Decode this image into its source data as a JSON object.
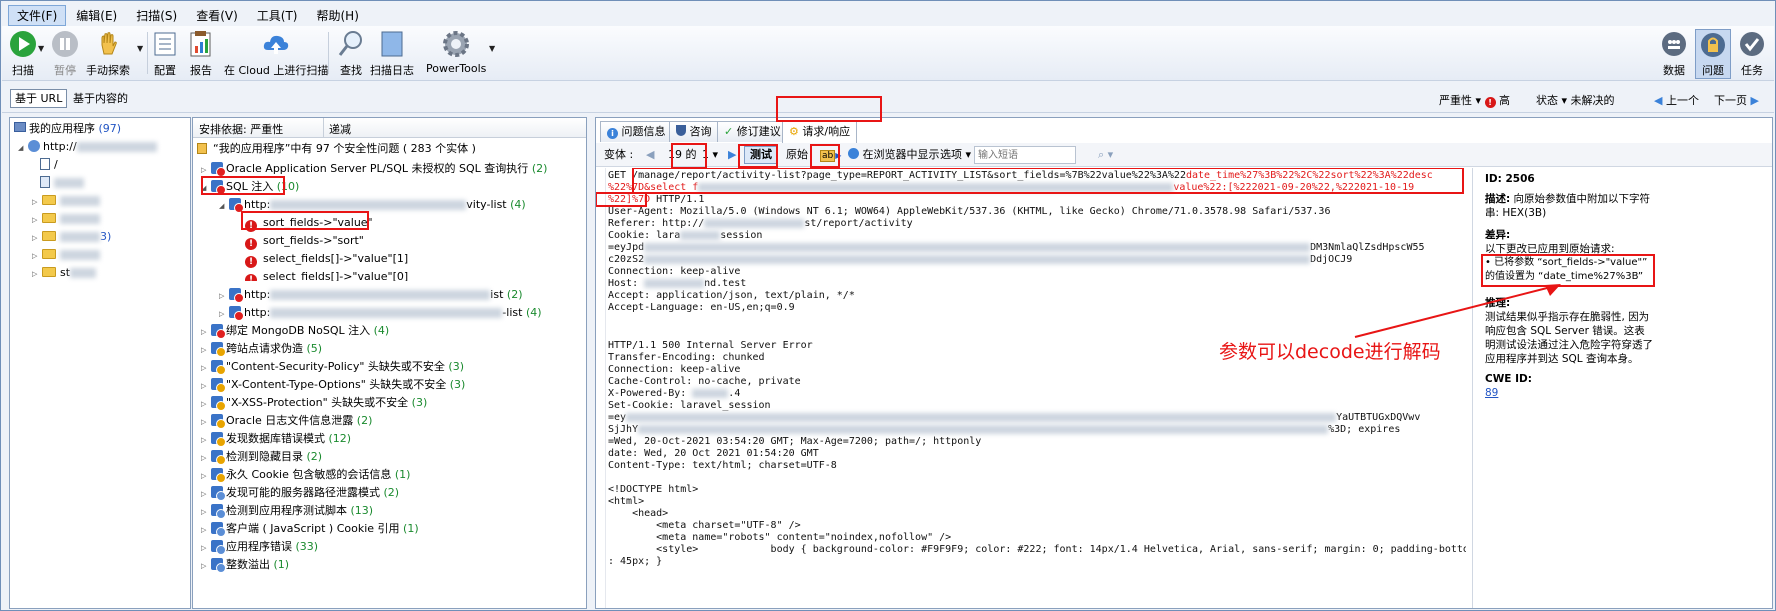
{
  "menu": [
    "文件(F)",
    "编辑(E)",
    "扫描(S)",
    "查看(V)",
    "工具(T)",
    "帮助(H)"
  ],
  "toolbar": {
    "scan": "扫描",
    "pause": "暂停",
    "manual": "手动探索",
    "config": "配置",
    "report": "报告",
    "cloud": "在 Cloud 上进行扫描",
    "find": "查找",
    "scanlog": "扫描日志",
    "powertools": "PowerTools",
    "data": "数据",
    "issues": "问题",
    "tasks": "任务"
  },
  "viewbar": {
    "url": "基于 URL",
    "content": "基于内容的",
    "severity": "严重性",
    "high": "高",
    "state": "状态",
    "unresolved": "未解决的",
    "prev": "上一个",
    "next": "下一页"
  },
  "left": {
    "root": "我的应用程序",
    "root_count": "(97)",
    "host": "http://",
    "item1": "/",
    "item_suffix": "3)",
    "item_st": "st"
  },
  "mid": {
    "col1": "安排依据: 严重性",
    "col2": "递减",
    "summary": "“我的应用程序”中有 97 个安全性问题 ( 283 个实体 )",
    "oracle": "Oracle Application Server PL/SQL 未授权的 SQL 查询执行",
    "oracle_n": "(2)",
    "sqli": "SQL 注入",
    "sqli_n": "(10)",
    "url1": "http:",
    "url1_suffix": "vity-list",
    "url1_n": "(4)",
    "p1": "sort_fields->\"value\"",
    "p2": "sort_fields->\"sort\"",
    "p3": "select_fields[]->\"value\"[1]",
    "p4": "select_fields[]->\"value\"[0]",
    "url2": "http:",
    "url2_suffix": "ist",
    "url2_n": "(2)",
    "url3": "http:",
    "url3_suffix": "-list",
    "url3_n": "(4)",
    "groups": [
      {
        "t": "绑定 MongoDB NoSQL 注入",
        "n": "(4)",
        "c": "red"
      },
      {
        "t": "跨站点请求伪造",
        "n": "(5)",
        "c": "gold"
      },
      {
        "t": "\"Content-Security-Policy\" 头缺失或不安全",
        "n": "(3)",
        "c": "gold"
      },
      {
        "t": "\"X-Content-Type-Options\" 头缺失或不安全",
        "n": "(3)",
        "c": "gold"
      },
      {
        "t": "\"X-XSS-Protection\" 头缺失或不安全",
        "n": "(3)",
        "c": "gold"
      },
      {
        "t": "Oracle 日志文件信息泄露",
        "n": "(2)",
        "c": "gold"
      },
      {
        "t": "发现数据库错误模式",
        "n": "(12)",
        "c": "gold"
      },
      {
        "t": "检测到隐藏目录",
        "n": "(2)",
        "c": "gold"
      },
      {
        "t": "永久 Cookie 包含敏感的会话信息",
        "n": "(1)",
        "c": "gold"
      },
      {
        "t": "发现可能的服务器路径泄露模式",
        "n": "(2)",
        "c": "blue"
      },
      {
        "t": "检测到应用程序测试脚本",
        "n": "(13)",
        "c": "blue"
      },
      {
        "t": "客户端 ( JavaScript ) Cookie 引用",
        "n": "(1)",
        "c": "blue"
      },
      {
        "t": "应用程序错误",
        "n": "(33)",
        "c": "blue"
      },
      {
        "t": "整数溢出",
        "n": "(1)",
        "c": "blue"
      }
    ]
  },
  "tabs": {
    "info": "问题信息",
    "advice": "咨询",
    "fix": "修订建议",
    "reqres": "请求/响应"
  },
  "subtb": {
    "variant": "变体 :",
    "of": "19 的",
    "idx": "1",
    "test": "测试",
    "orig": "原始",
    "browser": "在浏览器中显示",
    "options": "选项",
    "search_placeholder": "输入短语"
  },
  "code": {
    "l1a": "GET /manage/report/activity-list?page_type=REPORT_ACTIVITY_LIST&sort_fields=%7B%22value%22%3A%22",
    "l1b": "date_time%27%3B",
    "l1c": "%22%2C%22sort%22%3A%22desc",
    "l2a": "%22%7D&select_f",
    "l2b": "value%22:[%222021-09-20%22,%222021-10-19",
    "l3a": "%22]%7D",
    "l3b": " HTTP/1.1",
    "l4": "User-Agent: Mozilla/5.0 (Windows NT 6.1; WOW64) AppleWebKit/537.36 (KHTML, like Gecko) Chrome/71.0.3578.98 Safari/537.36",
    "l5a": "Referer: http://",
    "l5b": "st/report/activity",
    "l6a": "Cookie: lara",
    "l6b": "session",
    "l7a": "=eyJpd",
    "l7b": "DM3NmlaQlZsdHpscW55",
    "l8a": "c20zS2",
    "l8b": "DdjOCJ9",
    "l9": "Connection: keep-alive",
    "l10a": "Host: ",
    "l10b": "nd.test",
    "l11": "Accept: application/json, text/plain, */*",
    "l12": "Accept-Language: en-US,en;q=0.9",
    "r1": "HTTP/1.1 500 Internal Server Error",
    "r2": "Transfer-Encoding: chunked",
    "r3": "Connection: keep-alive",
    "r4": "Cache-Control: no-cache, private",
    "r5a": "X-Powered-By: ",
    "r5b": ".4",
    "r6": "Set-Cookie: laravel_session",
    "r7a": "=ey",
    "r7b": "YaUTBTUGxDQVwv",
    "r8a": "SjJhY",
    "r8b": "%3D; expires",
    "r9": "=Wed, 20-Oct-2021 03:54:20 GMT; Max-Age=7200; path=/; httponly",
    "r10": "date: Wed, 20 Oct 2021 01:54:20 GMT",
    "r11": "Content-Type: text/html; charset=UTF-8",
    "h1": "<!DOCTYPE html>",
    "h2": "<html>",
    "h3": "    <head>",
    "h4": "        <meta charset=\"UTF-8\" />",
    "h5": "        <meta name=\"robots\" content=\"noindex,nofollow\" />",
    "h6": "        <style>            body { background-color: #F9F9F9; color: #222; font: 14px/1.4 Helvetica, Arial, sans-serif; margin: 0; padding-bottom",
    "h7": ": 45px; }"
  },
  "info": {
    "id": "ID: 2506",
    "desc_t": "描述:",
    "desc": "向原始参数值中附加以下字符串: HEX(3B)",
    "diff_t": "差异:",
    "diff_intro": "以下更改已应用到原始请求:",
    "diff_item": "• 已将参数 “sort_fields->\"value\"” 的值设置为 “date_time%27%3B”",
    "reason_t": "推理:",
    "reason": "测试结果似乎指示存在脆弱性, 因为响应包含 SQL Server 错误。这表明测试设法通过注入危险字符穿透了应用程序并到达 SQL 查询本身。",
    "cwe_t": "CWE ID:",
    "cwe": "89"
  },
  "annotation": "参数可以decode进行解码"
}
